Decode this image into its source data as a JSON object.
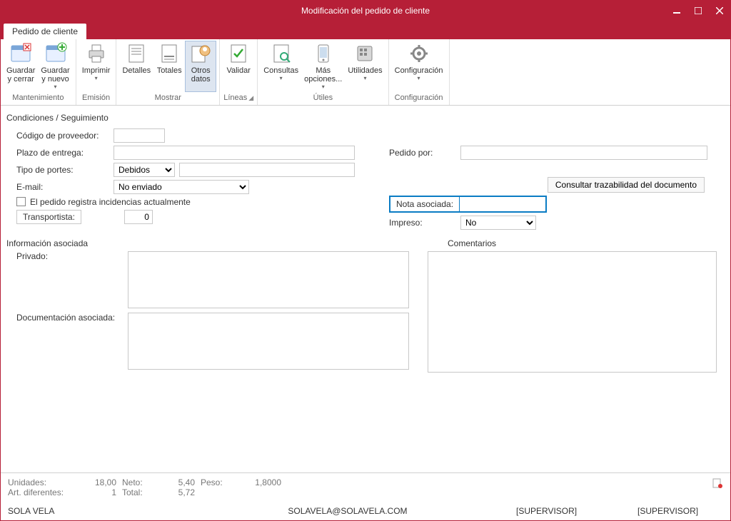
{
  "window": {
    "title": "Modificación del pedido de cliente"
  },
  "tab": {
    "label": "Pedido de cliente"
  },
  "ribbon": {
    "groups": [
      {
        "title": "Mantenimiento",
        "items": [
          {
            "label": "Guardar\ny cerrar",
            "drop": false
          },
          {
            "label": "Guardar\ny nuevo",
            "drop": true
          }
        ]
      },
      {
        "title": "Emisión",
        "items": [
          {
            "label": "Imprimir",
            "drop": true
          }
        ]
      },
      {
        "title": "Mostrar",
        "items": [
          {
            "label": "Detalles",
            "drop": false
          },
          {
            "label": "Totales",
            "drop": false
          },
          {
            "label": "Otros\ndatos",
            "drop": false,
            "selected": true
          }
        ]
      },
      {
        "title": "Líneas",
        "launcher": true,
        "items": [
          {
            "label": "Validar",
            "drop": false
          }
        ]
      },
      {
        "title": "Útiles",
        "items": [
          {
            "label": "Consultas",
            "drop": true
          },
          {
            "label": "Más\nopciones...",
            "drop": true
          },
          {
            "label": "Utilidades",
            "drop": true
          }
        ]
      },
      {
        "title": "Configuración",
        "items": [
          {
            "label": "Configuración",
            "drop": true
          }
        ]
      }
    ]
  },
  "sections": {
    "condiciones": "Condiciones / Seguimiento",
    "info": "Información asociada",
    "comentarios": "Comentarios"
  },
  "labels": {
    "codigo_proveedor": "Código de proveedor:",
    "plazo_entrega": "Plazo de entrega:",
    "tipo_portes": "Tipo de portes:",
    "email": "E-mail:",
    "incidencias": "El pedido registra incidencias actualmente",
    "transportista": "Transportista:",
    "pedido_por": "Pedido por:",
    "nota_asociada": "Nota asociada:",
    "impreso": "Impreso:",
    "privado": "Privado:",
    "doc_asociada": "Documentación asociada:",
    "btn_trazabilidad": "Consultar trazabilidad del documento"
  },
  "values": {
    "codigo_proveedor": "",
    "plazo_entrega": "",
    "tipo_portes": "Debidos",
    "tipo_portes_extra": "",
    "email": "No enviado",
    "transportista": "0",
    "pedido_por": "",
    "nota_asociada": "",
    "impreso": "No",
    "privado": "",
    "doc_asociada": "",
    "comentarios": ""
  },
  "footer": {
    "unidades_l": "Unidades:",
    "unidades_v": "18,00",
    "neto_l": "Neto:",
    "neto_v": "5,40",
    "peso_l": "Peso:",
    "peso_v": "1,8000",
    "art_l": "Art. diferentes:",
    "art_v": "1",
    "total_l": "Total:",
    "total_v": "5,72"
  },
  "status": {
    "company": "SOLA VELA",
    "email": "SOLAVELA@SOLAVELA.COM",
    "user1": "[SUPERVISOR]",
    "user2": "[SUPERVISOR]"
  }
}
